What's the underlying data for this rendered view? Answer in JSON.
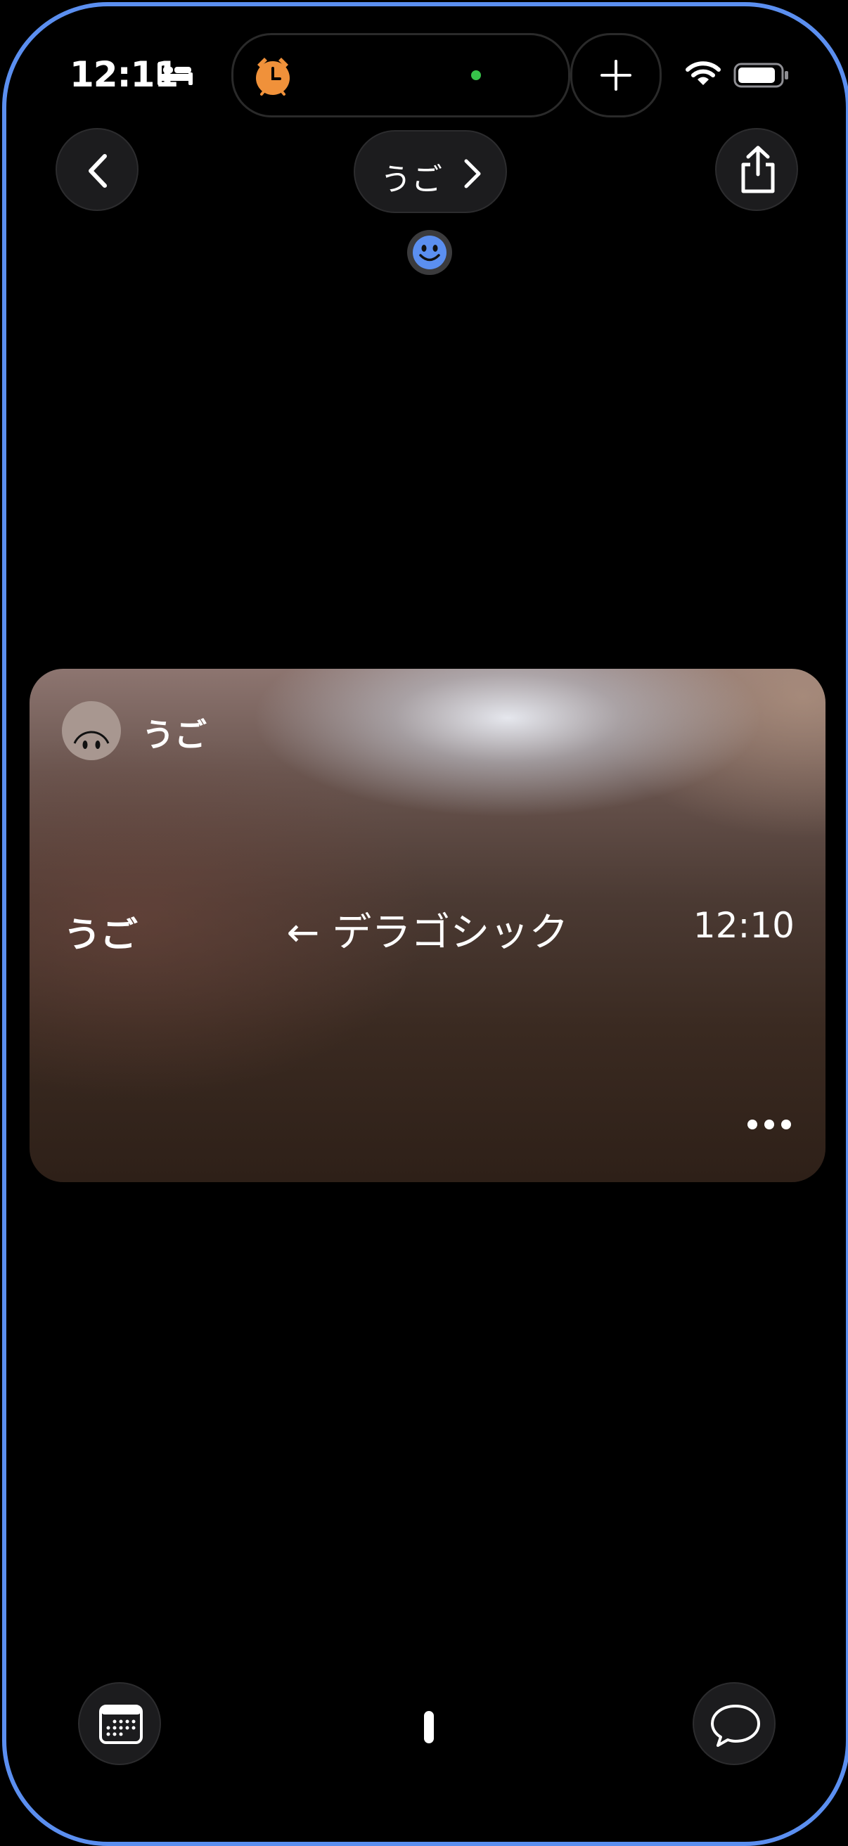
{
  "status_bar": {
    "time": "12:11",
    "icons": [
      "bed-icon",
      "alarm-icon",
      "plus-icon",
      "wifi-icon",
      "battery-icon"
    ],
    "alarm_color": "#f0913a",
    "camera_dot_color": "#37c24a"
  },
  "nav": {
    "back_icon": "chevron-left-icon",
    "title": "うご",
    "title_icon": "chevron-right-icon",
    "share_icon": "share-icon"
  },
  "reaction_icon": "smiley-icon",
  "card": {
    "sender_name": "うご",
    "logo_text": "うご",
    "message": "← デラゴシック",
    "time": "12:10",
    "more_icon": "ellipsis-icon"
  },
  "bottom_bar": {
    "left_icon": "calendar-icon",
    "right_icon": "chat-bubble-icon"
  },
  "colors": {
    "frame_border": "#5b8ff0",
    "background": "#000000",
    "button_bg": "#1c1c1e",
    "smiley": "#5b8ff0"
  }
}
